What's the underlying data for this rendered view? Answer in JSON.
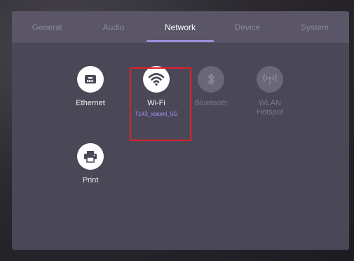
{
  "tabs": [
    {
      "label": "General",
      "active": false
    },
    {
      "label": "Audio",
      "active": false
    },
    {
      "label": "Network",
      "active": true
    },
    {
      "label": "Device",
      "active": false
    },
    {
      "label": "System",
      "active": false
    }
  ],
  "items": {
    "ethernet": {
      "label": "Ethernet",
      "enabled": true,
      "icon": "ethernet-icon"
    },
    "wifi": {
      "label": "Wi-Fi",
      "sublabel": "T143_xiaomi_5G",
      "enabled": true,
      "selected": true,
      "icon": "wifi-icon"
    },
    "bluetooth": {
      "label": "Bluetooth",
      "enabled": false,
      "icon": "bluetooth-icon"
    },
    "wlan_hotspot": {
      "label_line1": "WLAN",
      "label_line2": "Hotspot",
      "enabled": false,
      "icon": "hotspot-icon"
    },
    "print": {
      "label": "Print",
      "enabled": true,
      "icon": "printer-icon"
    }
  },
  "colors": {
    "panel": "#4a4757",
    "tabbar": "#5a5668",
    "accent": "#9b8fd9",
    "sublabel": "#a994ff",
    "selection": "#e0202a"
  }
}
